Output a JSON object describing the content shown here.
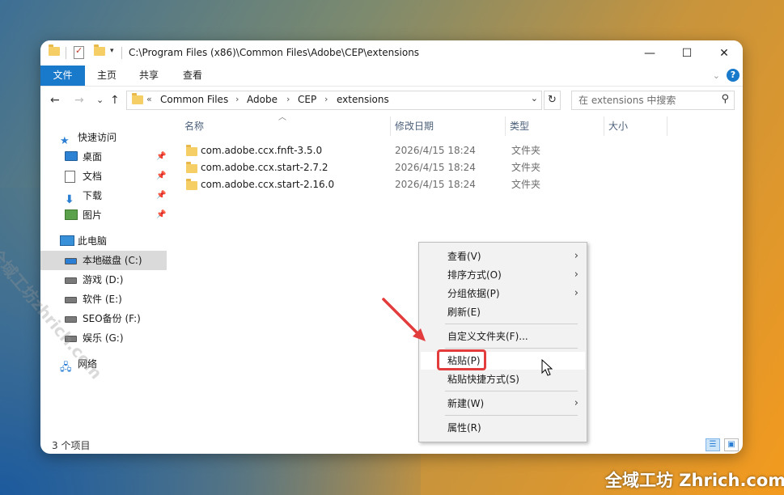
{
  "window": {
    "title_path": "C:\\Program Files (x86)\\Common Files\\Adobe\\CEP\\extensions",
    "controls": {
      "minimize": "—",
      "maximize": "☐",
      "close": "✕"
    }
  },
  "ribbon": {
    "tabs": [
      {
        "label": "文件"
      },
      {
        "label": "主页"
      },
      {
        "label": "共享"
      },
      {
        "label": "查看"
      }
    ],
    "help_label": "?"
  },
  "navigation": {
    "back": "←",
    "forward": "→",
    "recent": "⌄",
    "up": "↑"
  },
  "address": {
    "overflow": "«",
    "crumbs": [
      "Common Files",
      "Adobe",
      "CEP",
      "extensions"
    ],
    "separator": "›",
    "refresh": "↻"
  },
  "search": {
    "placeholder": "在 extensions 中搜索",
    "icon": "search-icon"
  },
  "sidebar": {
    "quick_access": "快速访问",
    "pinned": [
      {
        "label": "桌面",
        "icon": "desktop-icon"
      },
      {
        "label": "文档",
        "icon": "documents-icon"
      },
      {
        "label": "下载",
        "icon": "download-icon"
      },
      {
        "label": "图片",
        "icon": "pictures-icon"
      }
    ],
    "this_pc": "此电脑",
    "drives": [
      {
        "label": "本地磁盘 (C:)",
        "selected": true
      },
      {
        "label": "游戏 (D:)"
      },
      {
        "label": "软件 (E:)"
      },
      {
        "label": "SEO备份 (F:)"
      },
      {
        "label": "娱乐 (G:)"
      }
    ],
    "network": "网络"
  },
  "columns": {
    "name": "名称",
    "modified": "修改日期",
    "type": "类型",
    "size": "大小"
  },
  "files": [
    {
      "name": "com.adobe.ccx.fnft-3.5.0",
      "modified": "2026/4/15 18:24",
      "type": "文件夹"
    },
    {
      "name": "com.adobe.ccx.start-2.7.2",
      "modified": "2026/4/15 18:24",
      "type": "文件夹"
    },
    {
      "name": "com.adobe.ccx.start-2.16.0",
      "modified": "2026/4/15 18:24",
      "type": "文件夹"
    }
  ],
  "status": {
    "count_text": "3 个项目"
  },
  "context_menu": {
    "items": [
      {
        "label": "查看(V)",
        "submenu": true
      },
      {
        "label": "排序方式(O)",
        "submenu": true
      },
      {
        "label": "分组依据(P)",
        "submenu": true
      },
      {
        "label": "刷新(E)"
      },
      {
        "label": "自定义文件夹(F)..."
      },
      {
        "label": "粘贴(P)",
        "hover": true,
        "highlighted": true
      },
      {
        "label": "粘贴快捷方式(S)"
      },
      {
        "label": "新建(W)",
        "submenu": true
      },
      {
        "label": "属性(R)"
      }
    ],
    "submenu_arrow": "›"
  },
  "watermarks": {
    "diagonal": "全域工坊zhrich.com",
    "corner": "全域工坊 Zhrich.com"
  },
  "colors": {
    "accent": "#1979ca",
    "highlight": "#e23c3c",
    "folder": "#f5cf66"
  }
}
